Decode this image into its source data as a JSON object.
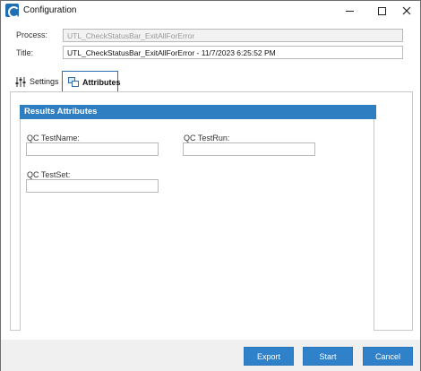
{
  "window": {
    "title": "Configuration",
    "icon": "app-c-icon"
  },
  "header": {
    "process_label": "Process:",
    "process_value": "UTL_CheckStatusBar_ExitAllForError",
    "title_label": "Title:",
    "title_value": "UTL_CheckStatusBar_ExitAllForError - 11/7/2023 6:25:52 PM"
  },
  "tabs": [
    {
      "label": "Settings",
      "icon": "sliders-icon",
      "active": false
    },
    {
      "label": "Attributes",
      "icon": "attributes-icon",
      "active": true
    }
  ],
  "results_attributes": {
    "header": "Results Attributes",
    "fields": [
      {
        "label": "QC TestName:",
        "value": ""
      },
      {
        "label": "QC TestRun:",
        "value": ""
      },
      {
        "label": "QC TestSet:",
        "value": ""
      }
    ]
  },
  "footer": {
    "export_label": "Export",
    "start_label": "Start",
    "cancel_label": "Cancel"
  },
  "colors": {
    "accent": "#2f82c9",
    "group_header": "#2f7ec1",
    "footer_bg": "#f0f0f0"
  }
}
